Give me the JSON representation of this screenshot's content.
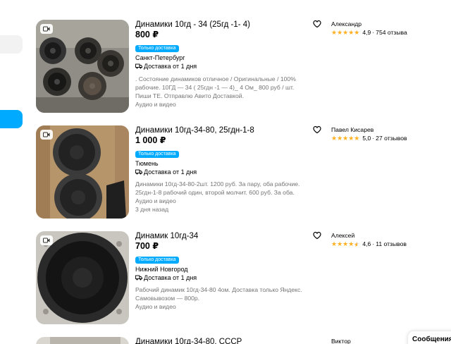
{
  "listings": [
    {
      "title": "Динамики 10гд - 34 (25гд -1- 4)",
      "price": "800 ₽",
      "badge": "Только доставка",
      "city": "Санкт-Петербург",
      "delivery": "Доставка от 1 дня",
      "description": ". Состояние динамиков отличное / Оригинальные / 100% рабочие. 10ГД — 34 ( 25гдн -1 — 4)_ 4 Ом_ 800 руб / шт. Пиши ТЕ. Отправлю Авито Доставкой.",
      "meta1": "Аудио и видео",
      "meta2": "",
      "seller": "Александр",
      "rating": "4,9",
      "reviews": "754 отзыва",
      "stars": "★★★★★"
    },
    {
      "title": "Динамики 10гд-34-80, 25гдн-1-8",
      "price": "1 000 ₽",
      "badge": "Только доставка",
      "city": "Тюмень",
      "delivery": "Доставка от 1 дня",
      "description": "Динамики 10гд-34-80-2шт. 1200 руб. За пару, оба рабочие. 25гдн-1-8 рабочий один, второй молчит. 600 руб. За оба.",
      "meta1": "Аудио и видео",
      "meta2": "3 дня назад",
      "seller": "Павел Кисарев",
      "rating": "5,0",
      "reviews": "27 отзывов",
      "stars": "★★★★★"
    },
    {
      "title": "Динамик 10гд-34",
      "price": "700 ₽",
      "badge": "Только доставка",
      "city": "Нижний Новгород",
      "delivery": "Доставка от 1 дня",
      "description": "Рабочий динамик 10гд-34-80 4ом. Доставка только Яндекс. Самовывозом — 800р.",
      "meta1": "Аудио и видео",
      "meta2": "",
      "seller": "Алексей",
      "rating": "4,6",
      "reviews": "11 отзывов",
      "stars": "★★★★★"
    },
    {
      "title": "Динамики 10гд-34-80, СССР",
      "seller": "Виктор"
    }
  ],
  "messages_tab": "Сообщения",
  "colors": {
    "accent": "#00aaff",
    "star": "#ffb021",
    "muted": "#757575"
  }
}
